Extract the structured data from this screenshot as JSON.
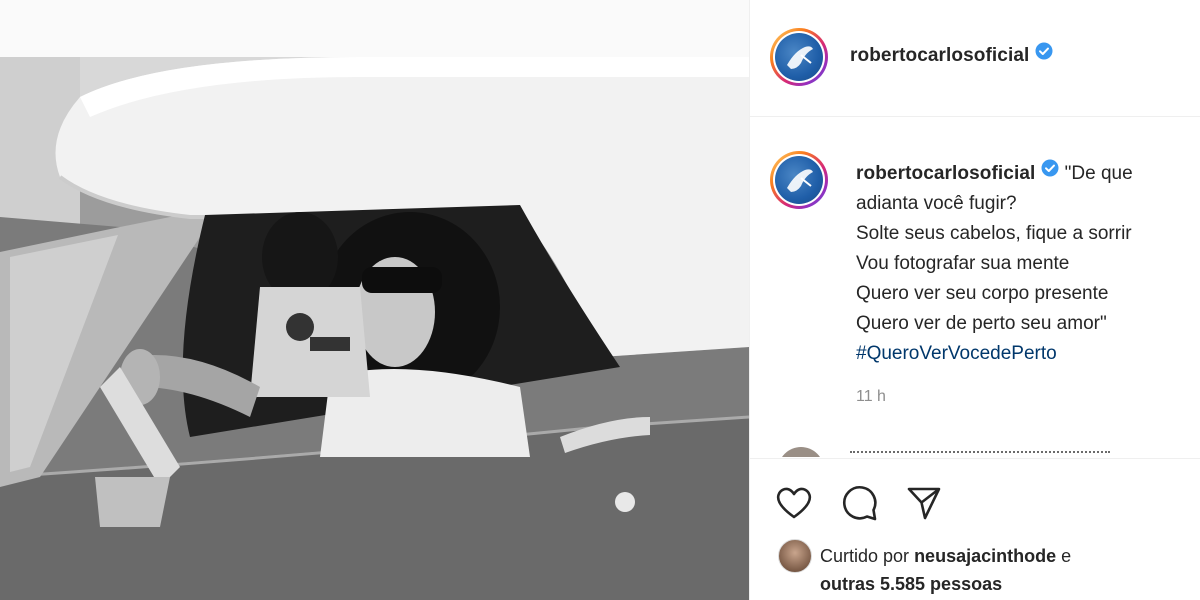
{
  "post": {
    "username": "robertocarlosoficial",
    "verified": true,
    "image_alt": "Black and white photo of a man with curly hair and sunglasses driving a convertible car with a white top"
  },
  "caption": {
    "username": "robertocarlosoficial",
    "lines": [
      "\"De que",
      "adianta você fugir?",
      "Solte seus cabelos, fique a sorrir",
      "Vou fotografar sua mente",
      "Quero ver seu corpo presente",
      "Quero ver de perto seu amor\""
    ],
    "hashtag": "#QueroVerVocedePerto",
    "timestamp": "11 h"
  },
  "actions": {
    "like_icon": "heart-icon",
    "comment_icon": "comment-icon",
    "share_icon": "send-icon"
  },
  "likes": {
    "prefix": "Curtido por",
    "user": "neusajacinthode",
    "conjunction": "e",
    "others": "outras 5.585 pessoas"
  },
  "colors": {
    "text": "#262626",
    "muted": "#8e8e8e",
    "hashtag": "#00376b",
    "verified": "#3897f0",
    "border": "#efefef"
  }
}
